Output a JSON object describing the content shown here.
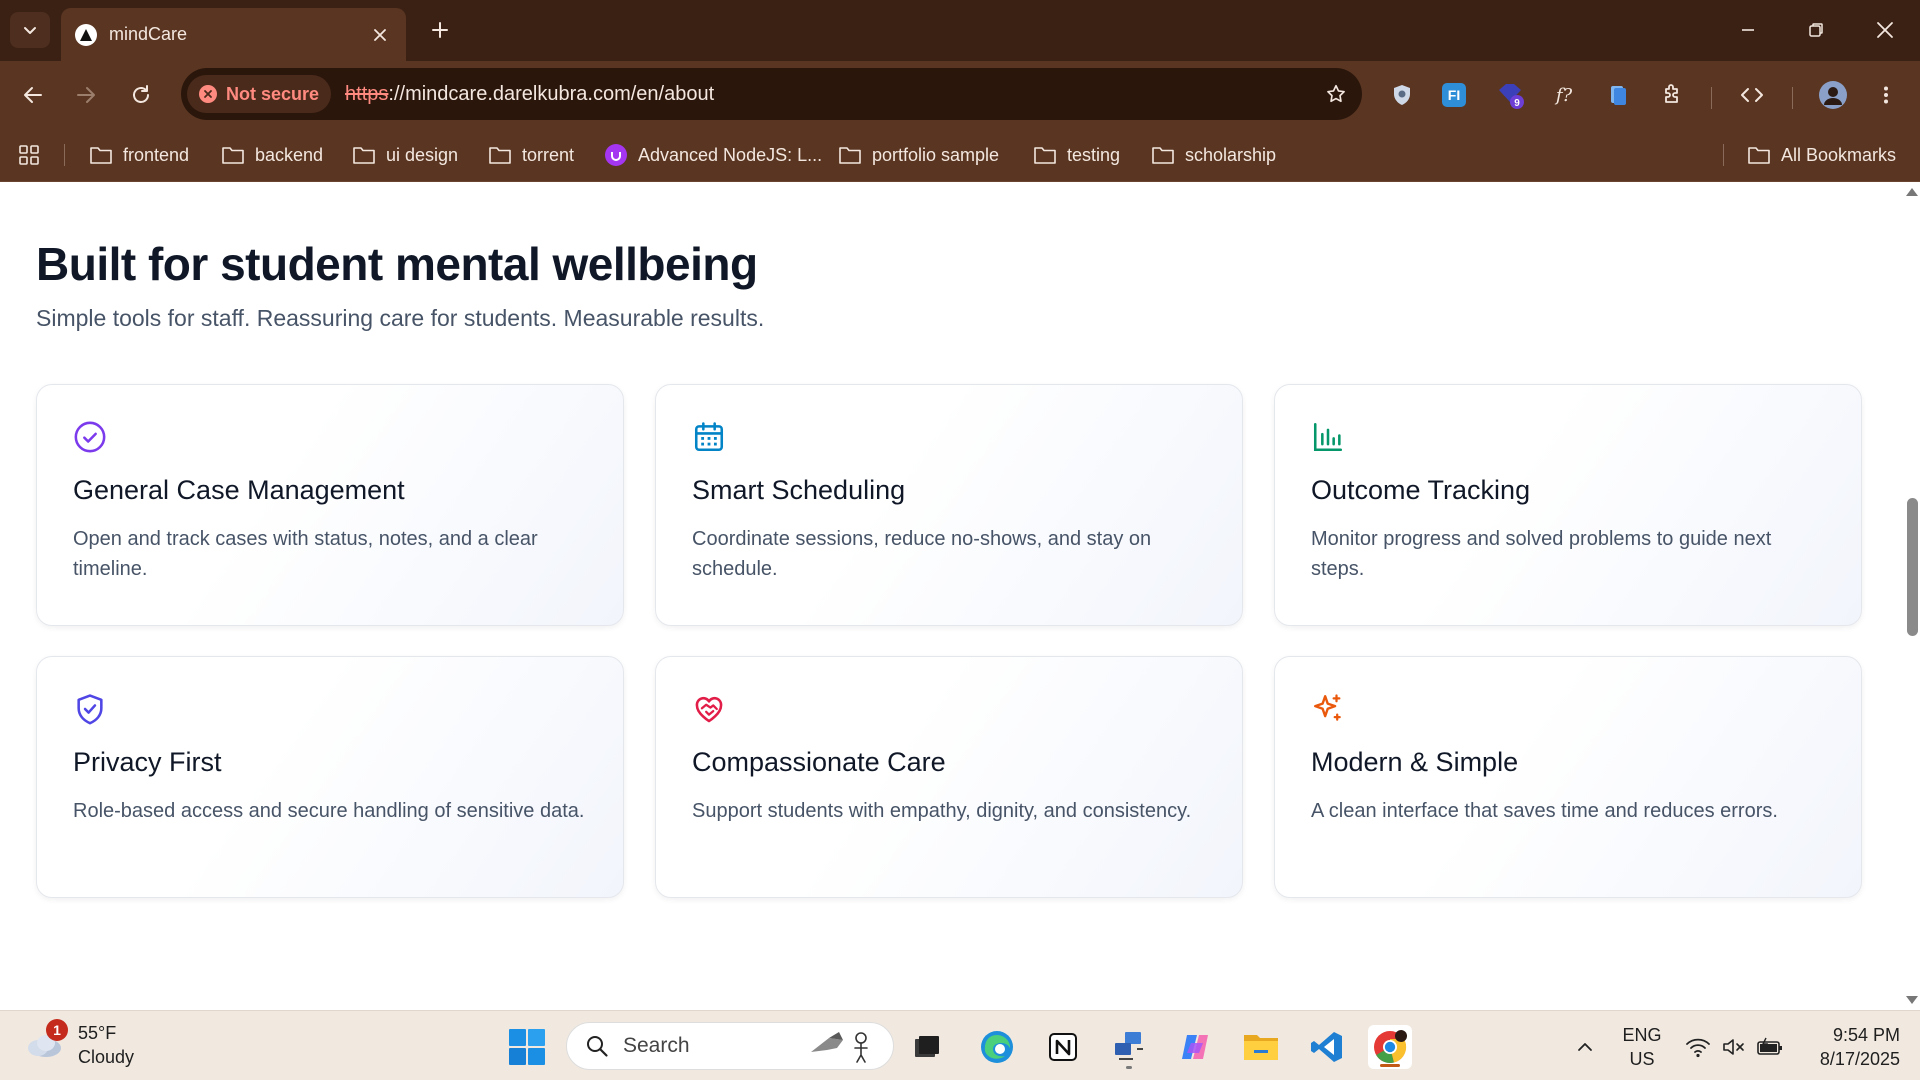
{
  "browser": {
    "tab_title": "mindCare",
    "security_label": "Not secure",
    "url_scheme": "https",
    "url_rest": "://mindcare.darelkubra.com/en/about",
    "extension_badge": "9"
  },
  "bookmarks": {
    "items": [
      {
        "label": "frontend",
        "type": "folder"
      },
      {
        "label": "backend",
        "type": "folder"
      },
      {
        "label": "ui design",
        "type": "folder"
      },
      {
        "label": "torrent",
        "type": "folder"
      },
      {
        "label": "Advanced NodeJS: L...",
        "type": "site"
      },
      {
        "label": "portfolio sample",
        "type": "folder"
      },
      {
        "label": "testing",
        "type": "folder"
      },
      {
        "label": "scholarship",
        "type": "folder"
      }
    ],
    "all_label": "All Bookmarks"
  },
  "page": {
    "title": "Built for student mental wellbeing",
    "subtitle": "Simple tools for staff. Reassuring care for students. Measurable results.",
    "features": [
      {
        "icon": "check-circle-icon",
        "color": "#7c3aed",
        "title": "General Case Management",
        "desc": "Open and track cases with status, notes, and a clear timeline."
      },
      {
        "icon": "calendar-icon",
        "color": "#0284c7",
        "title": "Smart Scheduling",
        "desc": "Coordinate sessions, reduce no-shows, and stay on schedule."
      },
      {
        "icon": "bar-chart-icon",
        "color": "#059669",
        "title": "Outcome Tracking",
        "desc": "Monitor progress and solved problems to guide next steps."
      },
      {
        "icon": "shield-check-icon",
        "color": "#4f46e5",
        "title": "Privacy First",
        "desc": "Role-based access and secure handling of sensitive data."
      },
      {
        "icon": "heart-handshake-icon",
        "color": "#e11d48",
        "title": "Compassionate Care",
        "desc": "Support students with empathy, dignity, and consistency."
      },
      {
        "icon": "sparkles-icon",
        "color": "#ea580c",
        "title": "Modern & Simple",
        "desc": "A clean interface that saves time and reduces errors."
      }
    ]
  },
  "taskbar": {
    "weather_temp": "55°F",
    "weather_desc": "Cloudy",
    "weather_badge": "1",
    "search_placeholder": "Search",
    "lang_line1": "ENG",
    "lang_line2": "US",
    "time": "9:54 PM",
    "date": "8/17/2025"
  }
}
